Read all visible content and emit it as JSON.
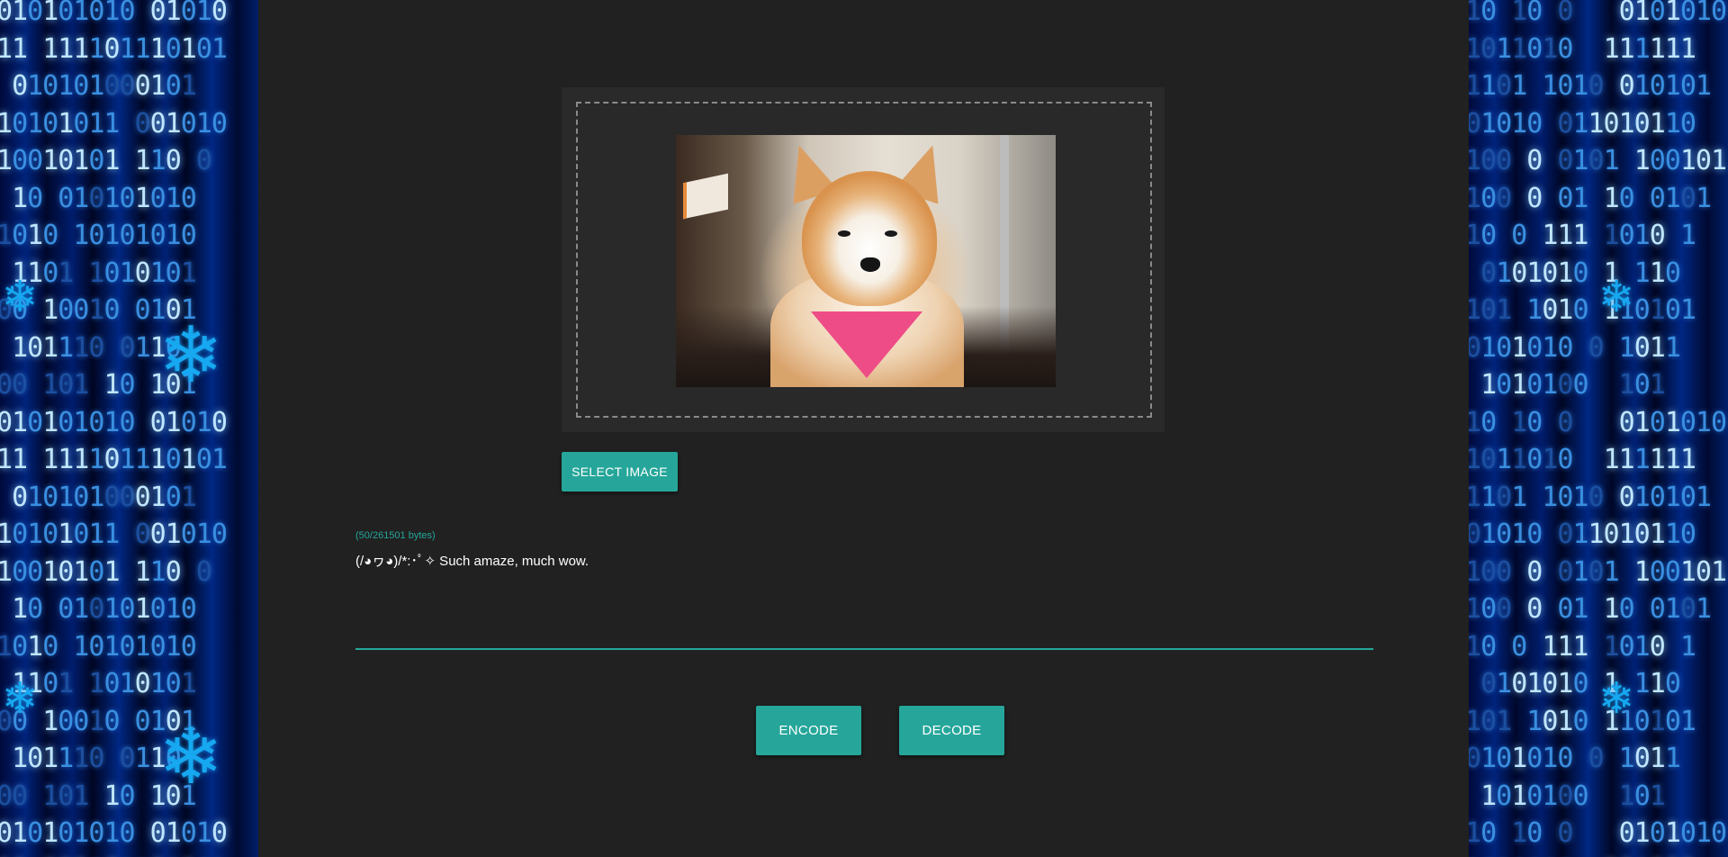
{
  "upload": {
    "preview_alt": "Akita dog wearing a pink bandana",
    "select_button_label": "SELECT IMAGE"
  },
  "message": {
    "byte_counter": "(50/261501 bytes)",
    "value": "(/◕ヮ◕)/*:･ﾟ✧ Such amaze, much wow."
  },
  "actions": {
    "encode_label": "ENCODE",
    "decode_label": "DECODE"
  },
  "colors": {
    "accent": "#26a69a",
    "panel_background": "#212121",
    "card_background": "#2a2a2a",
    "side_background": "#00061a"
  },
  "icons": [
    "snowflake-icon"
  ]
}
